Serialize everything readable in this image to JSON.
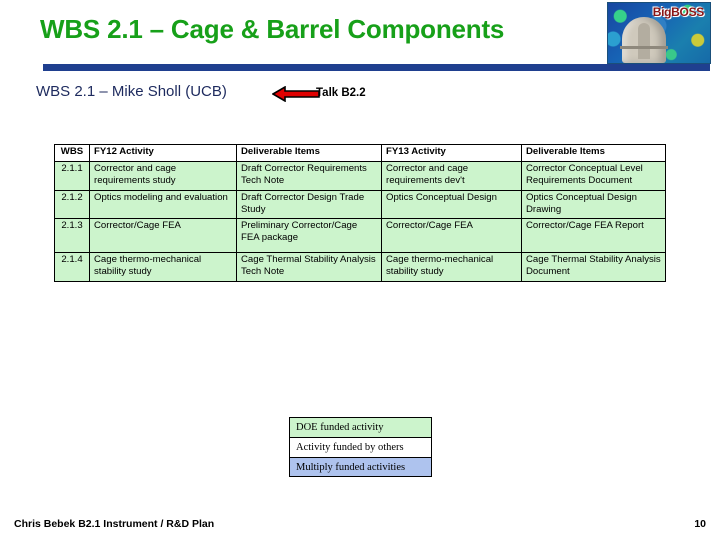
{
  "slide": {
    "title": "WBS 2.1 – Cage & Barrel Components",
    "subtitle": "WBS 2.1 – Mike Sholl (UCB)",
    "talk_label": "Talk B2.2",
    "title_color": "#17a019",
    "rule_color": "#1f3f8f",
    "subtitle_color": "#1d2a5e",
    "arrow_color": "#e00000"
  },
  "logo": {
    "text": "BigBOSS"
  },
  "table": {
    "headers": [
      "WBS",
      "FY12 Activity",
      "Deliverable Items",
      "FY13 Activity",
      "Deliverable Items"
    ],
    "rows": [
      {
        "wbs": "2.1.1",
        "fy12_activity": "Corrector and cage requirements study",
        "deliverable_1": "Draft Corrector Requirements Tech Note",
        "fy13_activity": "Corrector and cage requirements dev't",
        "deliverable_2": "Corrector Conceptual Level Requirements Document"
      },
      {
        "wbs": "2.1.2",
        "fy12_activity": "Optics modeling and evaluation",
        "deliverable_1": "Draft Corrector Design Trade Study",
        "fy13_activity": "Optics Conceptual Design",
        "deliverable_2": "Optics Conceptual Design Drawing"
      },
      {
        "wbs": "2.1.3",
        "fy12_activity": "Corrector/Cage FEA",
        "deliverable_1": "Preliminary Corrector/Cage FEA package",
        "fy13_activity": "Corrector/Cage FEA",
        "deliverable_2": "Corrector/Cage FEA Report"
      },
      {
        "wbs": "2.1.4",
        "fy12_activity": "Cage thermo-mechanical stability study",
        "deliverable_1": "Cage Thermal Stability Analysis Tech Note",
        "fy13_activity": "Cage thermo-mechanical stability study",
        "deliverable_2": "Cage Thermal Stability Analysis Document"
      }
    ],
    "cell_color": "#ccf4cc"
  },
  "legend": {
    "items": [
      {
        "label": "DOE funded activity",
        "color": "#ccf4cc"
      },
      {
        "label": "Activity funded by others",
        "color": "#ffffff"
      },
      {
        "label": "Multiply funded activities",
        "color": "#aec3ee"
      }
    ]
  },
  "footer": {
    "text": "Chris Bebek B2.1 Instrument / R&D Plan",
    "page_number": "10"
  }
}
